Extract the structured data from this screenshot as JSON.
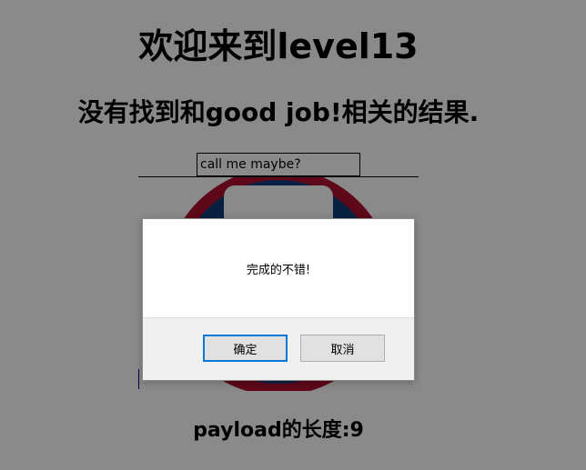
{
  "page": {
    "title": "欢迎来到level13",
    "result_text": "没有找到和good job!相关的结果.",
    "search_input_value": "call me maybe?",
    "payload_length_text": "payload的长度:9"
  },
  "dialog": {
    "message": "完成的不错!",
    "ok_label": "确定",
    "cancel_label": "取消"
  },
  "colors": {
    "overlay": "#888888",
    "logo_red": "#b01030",
    "logo_blue": "#0f3c78",
    "focus_border": "#0078d7",
    "dialog_footer": "#f0f0f0"
  }
}
